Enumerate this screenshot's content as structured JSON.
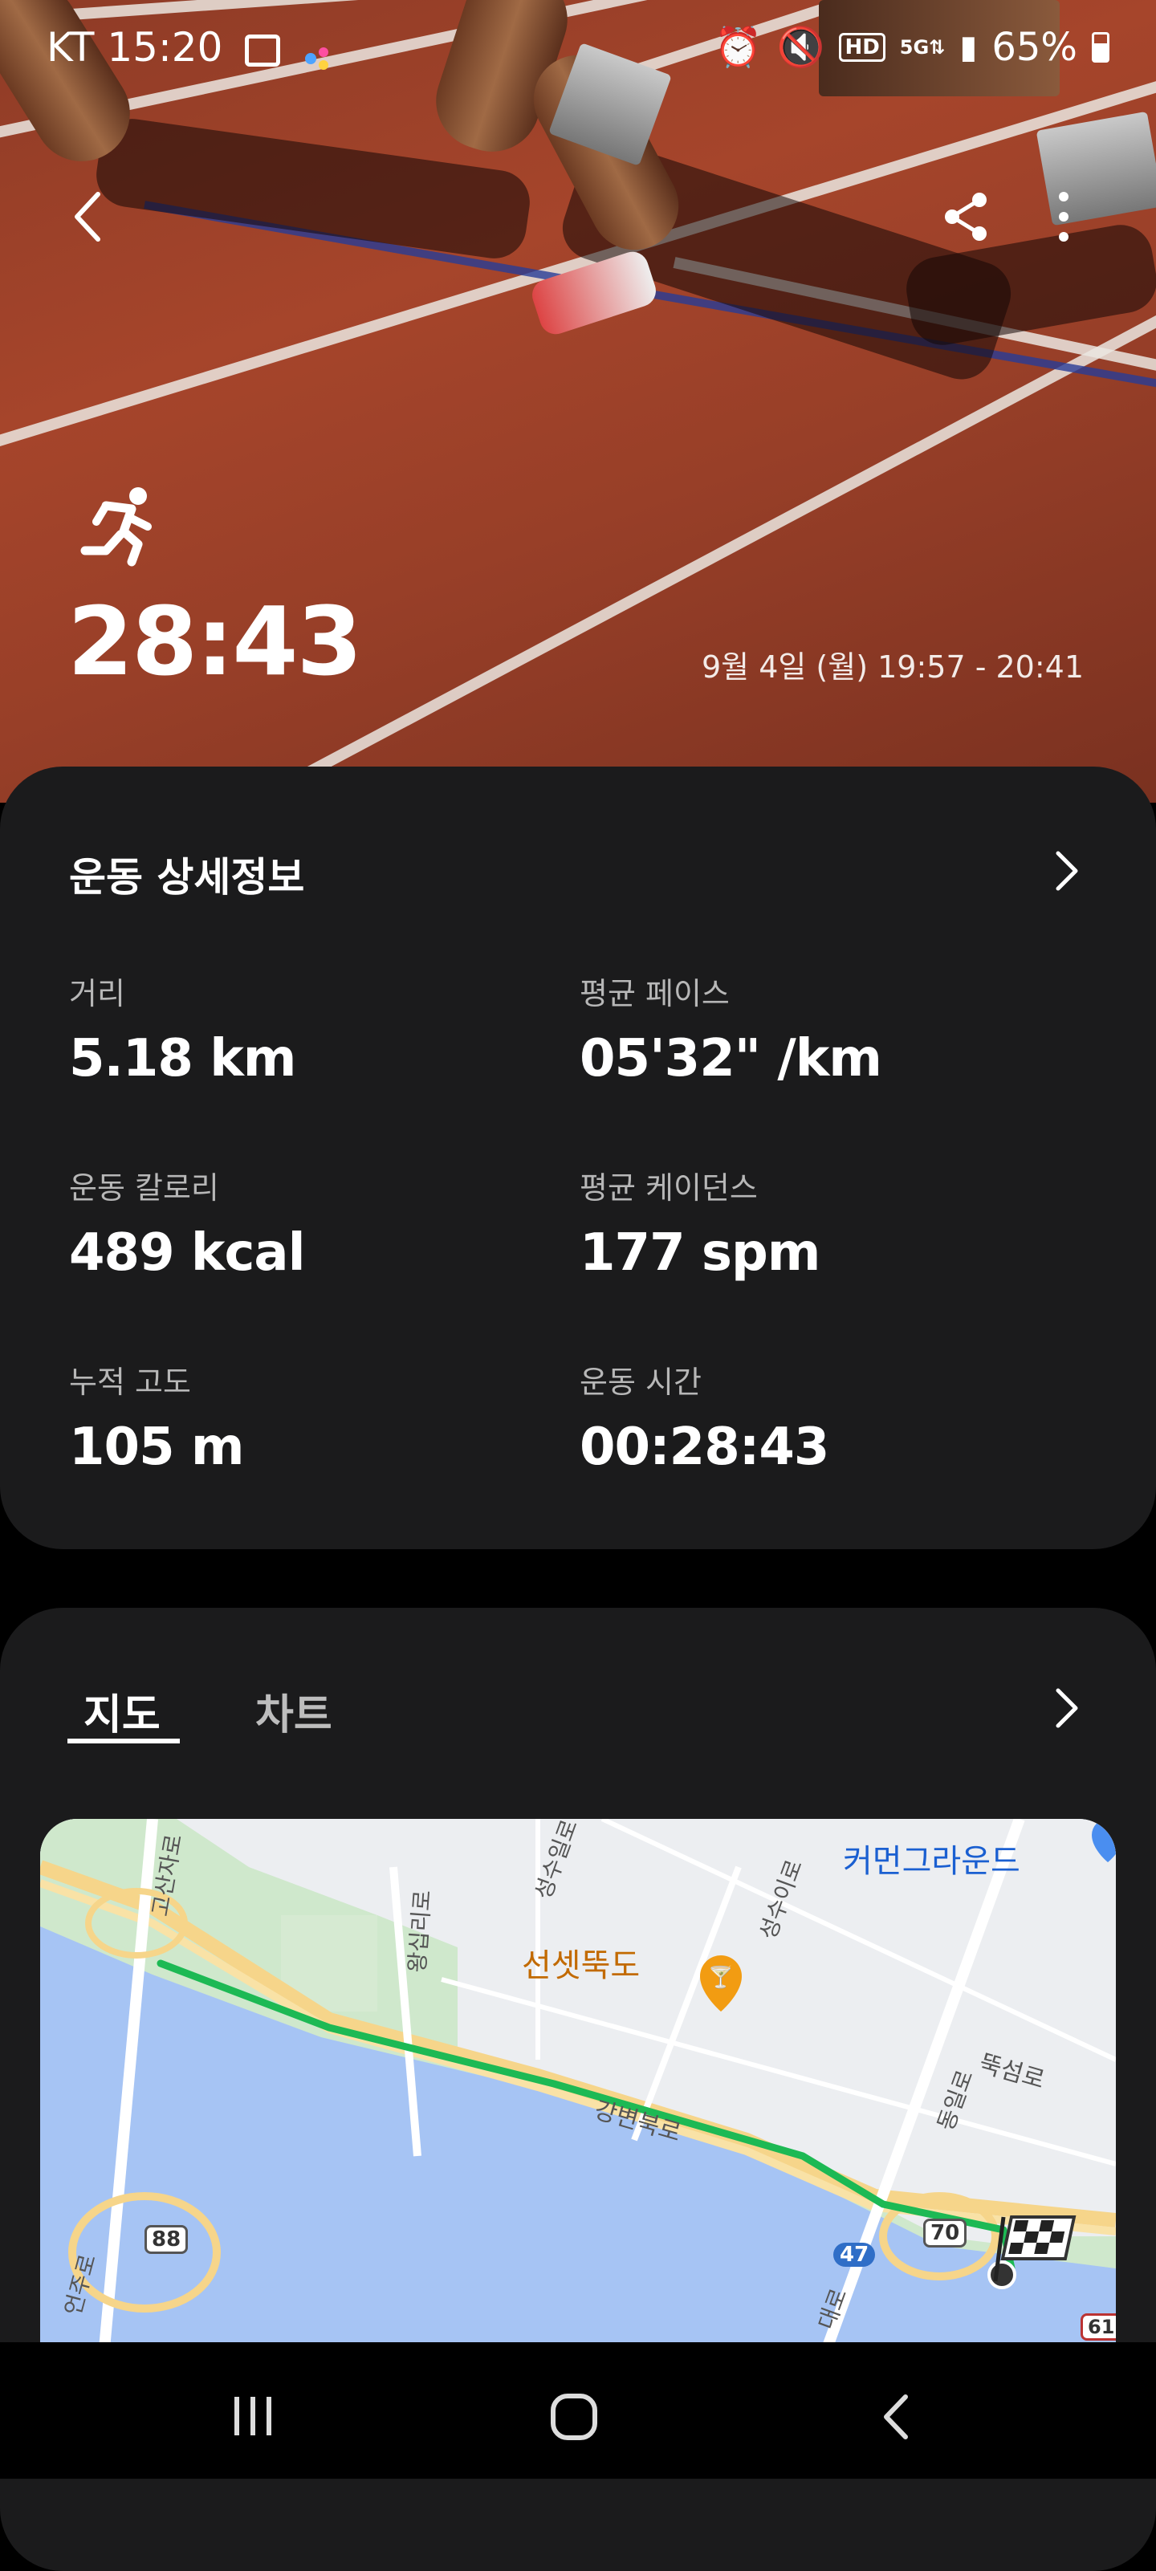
{
  "status_bar": {
    "carrier_time": "KT 15:20",
    "battery": "65%",
    "icons": [
      "gallery-icon",
      "assistant-icon",
      "alarm-icon",
      "mute-icon",
      "hd-icon",
      "5g-icon",
      "signal-icon",
      "battery-icon"
    ]
  },
  "hero": {
    "duration": "28:43",
    "date_range": "9월 4일 (월) 19:57 - 20:41",
    "activity_icon": "running-icon"
  },
  "details": {
    "title": "운동 상세정보",
    "stats": [
      {
        "label": "거리",
        "value": "5.18 km"
      },
      {
        "label": "평균 페이스",
        "value": "05'32\" /km"
      },
      {
        "label": "운동 칼로리",
        "value": "489 kcal"
      },
      {
        "label": "평균 케이던스",
        "value": "177 spm"
      },
      {
        "label": "누적 고도",
        "value": "105 m"
      },
      {
        "label": "운동 시간",
        "value": "00:28:43"
      }
    ]
  },
  "map_section": {
    "tabs": [
      "지도",
      "차트"
    ],
    "active_tab": "지도",
    "map_labels": {
      "poi_1": "커먼그라운드",
      "poi_2": "선셋뚝도",
      "road_1": "고산자로",
      "road_2": "왕십리로",
      "road_3": "성수일로",
      "road_4": "성수이로",
      "road_5": "강변북로",
      "road_6": "동일로",
      "road_7": "뚝섬로",
      "road_8": "언주로",
      "road_9": "대로",
      "shield_1": "88",
      "shield_2": "70",
      "shield_3": "47",
      "shield_4": "61"
    }
  },
  "colors": {
    "card_bg": "#1b1b1c",
    "route": "#1db954",
    "water": "#a6c4f4",
    "poi": "#f29c12"
  }
}
